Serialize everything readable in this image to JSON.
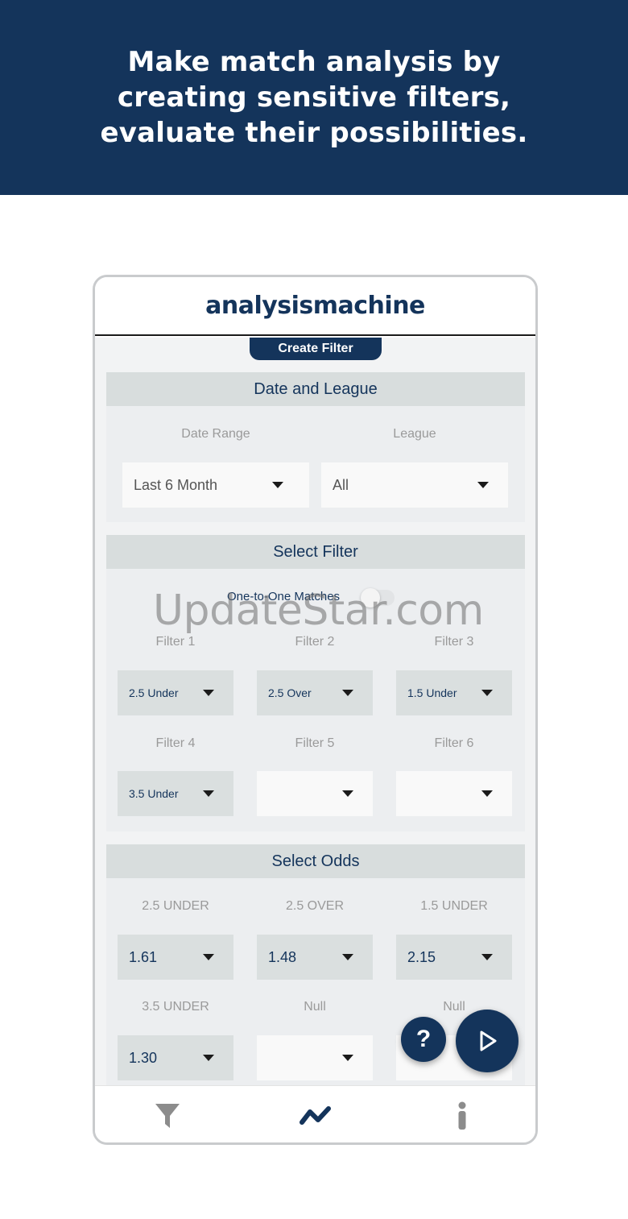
{
  "banner": {
    "text": "Make match analysis by creating sensitive filters, evaluate their possibilities."
  },
  "app": {
    "title": "analysismachine",
    "tab": "Create Filter"
  },
  "date_league": {
    "heading": "Date and League",
    "date_label": "Date Range",
    "date_value": "Last 6 Month",
    "league_label": "League",
    "league_value": "All"
  },
  "select_filter": {
    "heading": "Select Filter",
    "one_to_one_label": "One-to-One Matches",
    "one_to_one_on": false,
    "filters": [
      {
        "label": "Filter 1",
        "value": "2.5 Under"
      },
      {
        "label": "Filter 2",
        "value": "2.5 Over"
      },
      {
        "label": "Filter 3",
        "value": "1.5 Under"
      },
      {
        "label": "Filter 4",
        "value": "3.5 Under"
      },
      {
        "label": "Filter 5",
        "value": ""
      },
      {
        "label": "Filter 6",
        "value": ""
      }
    ]
  },
  "select_odds": {
    "heading": "Select Odds",
    "odds": [
      {
        "label": "2.5 UNDER",
        "value": "1.61"
      },
      {
        "label": "2.5 OVER",
        "value": "1.48"
      },
      {
        "label": "1.5 UNDER",
        "value": "2.15"
      },
      {
        "label": "3.5 UNDER",
        "value": "1.30"
      },
      {
        "label": "Null",
        "value": ""
      },
      {
        "label": "Null",
        "value": ""
      }
    ]
  },
  "fab": {
    "help": "?"
  },
  "watermark": "UpdateStar.com",
  "colors": {
    "brand": "#14345b",
    "section_header": "#d8dddd",
    "select_grey": "#dadfdf"
  },
  "icons": {
    "nav": [
      "filter-icon",
      "trend-icon",
      "info-icon"
    ],
    "fab": [
      "help-icon",
      "play-icon"
    ]
  }
}
